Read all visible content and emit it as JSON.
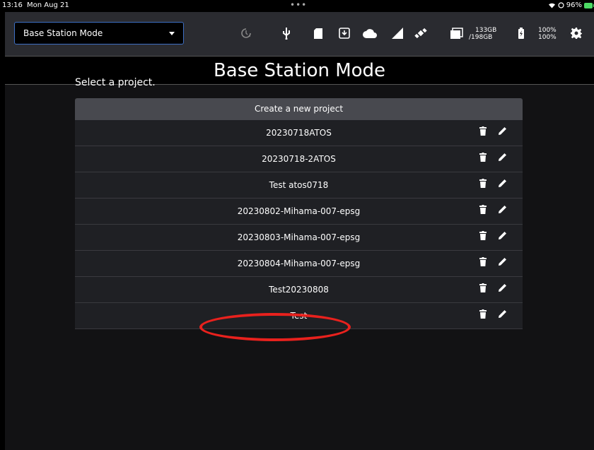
{
  "status_bar": {
    "time": "13:16",
    "date": "Mon Aug 21",
    "battery": "96%"
  },
  "toolbar": {
    "mode_select": "Base Station Mode",
    "storage_used": "133GB",
    "storage_total": "/198GB",
    "battery_top": "100%",
    "battery_bottom": "100%"
  },
  "page": {
    "title": "Base Station Mode",
    "prompt": "Select a project."
  },
  "projects": {
    "create_label": "Create a new project",
    "items": [
      "20230718ATOS",
      "20230718-2ATOS",
      "Test atos0718",
      "20230802-Mihama-007-epsg",
      "20230803-Mihama-007-epsg",
      "20230804-Mihama-007-epsg",
      "Test20230808",
      "Test"
    ]
  },
  "colors": {
    "toolbar_bg": "#2a2b30",
    "accent_border": "#3d6fc4",
    "highlight": "#e8211d"
  },
  "icons": [
    "clock-icon",
    "usb-icon",
    "sd-card-icon",
    "download-icon",
    "cloud-icon",
    "signal-icon",
    "satellite-icon",
    "folder-icon",
    "battery-icon",
    "gear-icon",
    "trash-icon",
    "pencil-icon"
  ]
}
